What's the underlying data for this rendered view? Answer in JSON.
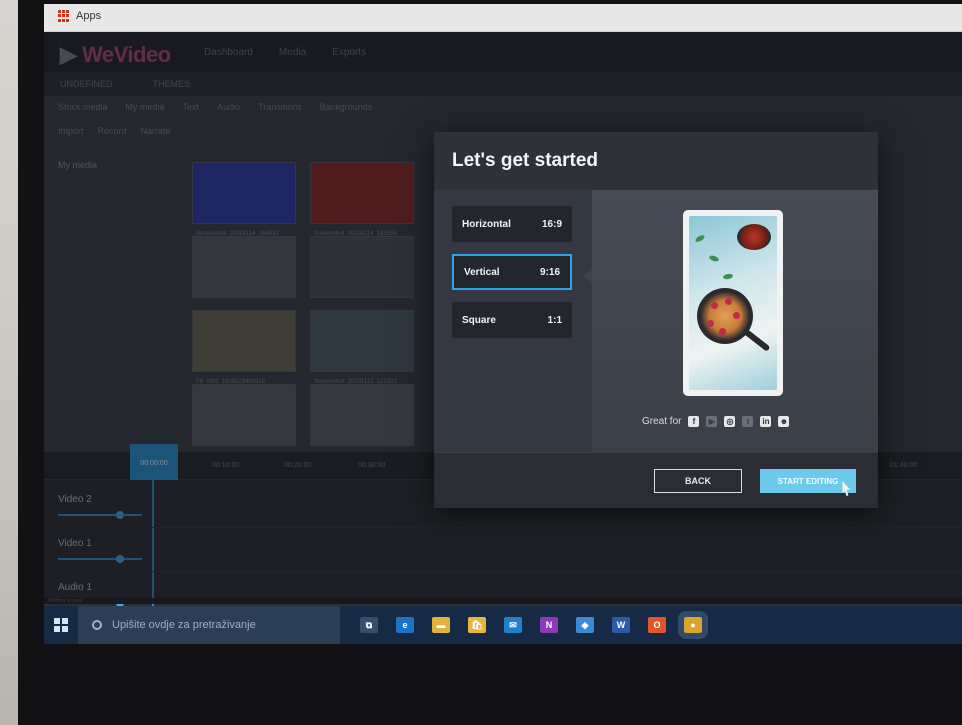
{
  "browser": {
    "bookmarks": {
      "apps_label": "Apps"
    }
  },
  "app": {
    "logo": {
      "prefix": "▶ ",
      "brand": "WeVideo"
    },
    "top_nav": [
      "Dashboard",
      "Media",
      "Exports"
    ],
    "subbar": [
      "UNDEFINED",
      "THEMES"
    ],
    "toolbar": [
      "Stock media",
      "My media",
      "Text",
      "Audio",
      "Transitions",
      "Backgrounds"
    ],
    "toolbar2": [
      "Import",
      "Record",
      "Narrate"
    ],
    "sidebar_label": "My media",
    "thumbs": [
      {
        "caption": "Screenshot_20201114_164832",
        "color": "#2f3fa8"
      },
      {
        "caption": "Screenshot_20201114_192556",
        "color": "#8a2a2a"
      },
      {
        "caption": "",
        "color": "#55595f"
      },
      {
        "caption": "",
        "color": "#4c5056"
      },
      {
        "caption": "FB_IMG_1605629460916",
        "color": "#6b6a58"
      },
      {
        "caption": "Screenshot_20201113_121203",
        "color": "#4e5b6b"
      },
      {
        "caption": "",
        "color": "#5a5e66"
      },
      {
        "caption": "",
        "color": "#5a5e66"
      }
    ],
    "timeline": {
      "playhead_time": "00:00:00",
      "ticks": [
        "00:10:00",
        "00:20:00",
        "00:30:00",
        "01:40:00"
      ],
      "tracks": [
        "Video 2",
        "Video 1",
        "Audio 1"
      ],
      "status": "Nothing to save"
    }
  },
  "modal": {
    "title": "Let's get started",
    "options": [
      {
        "label": "Horizontal",
        "ratio": "16:9",
        "selected": false
      },
      {
        "label": "Vertical",
        "ratio": "9:16",
        "selected": true
      },
      {
        "label": "Square",
        "ratio": "1:1",
        "selected": false
      }
    ],
    "great_for_label": "Great for",
    "social_icons": [
      {
        "name": "facebook-icon",
        "glyph": "f",
        "active": true
      },
      {
        "name": "youtube-icon",
        "glyph": "▶",
        "active": false
      },
      {
        "name": "instagram-icon",
        "glyph": "◎",
        "active": true
      },
      {
        "name": "twitter-icon",
        "glyph": "t",
        "active": false
      },
      {
        "name": "linkedin-icon",
        "glyph": "in",
        "active": true
      },
      {
        "name": "snapchat-icon",
        "glyph": "☻",
        "active": true
      }
    ],
    "back_label": "BACK",
    "start_label": "START EDITING"
  },
  "taskbar": {
    "search_placeholder": "Upišite ovdje za pretraživanje",
    "apps": [
      {
        "name": "task-view-icon",
        "glyph": "⧉",
        "color": "#3a4e6c"
      },
      {
        "name": "edge-icon",
        "glyph": "e",
        "color": "#1b74c8"
      },
      {
        "name": "file-explorer-icon",
        "glyph": "▬",
        "color": "#e2b23a"
      },
      {
        "name": "store-icon",
        "glyph": "🛍",
        "color": "#e8b63a"
      },
      {
        "name": "mail-icon",
        "glyph": "✉",
        "color": "#1f7fd0"
      },
      {
        "name": "onenote-icon",
        "glyph": "N",
        "color": "#8a3bb5"
      },
      {
        "name": "app-blue-icon",
        "glyph": "◆",
        "color": "#3a8ad6"
      },
      {
        "name": "word-icon",
        "glyph": "W",
        "color": "#2b5aa8"
      },
      {
        "name": "office-icon",
        "glyph": "O",
        "color": "#e0582a"
      },
      {
        "name": "chrome-icon",
        "glyph": "●",
        "color": "#d9a62a"
      }
    ]
  }
}
